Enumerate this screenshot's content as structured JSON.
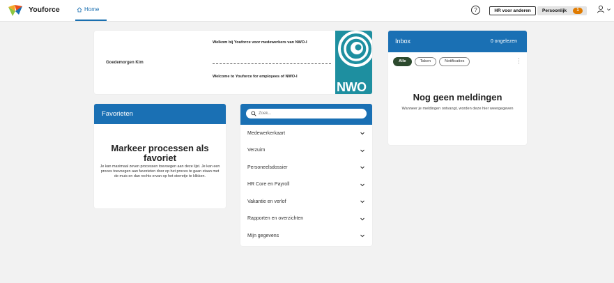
{
  "header": {
    "brand": "Youforce",
    "nav_home": "Home",
    "help_glyph": "?",
    "hr_button": "HR voor anderen",
    "personal_button": "Persoonlijk",
    "personal_badge": "1"
  },
  "welcome": {
    "greeting": "Goedemorgen Kim",
    "text_nl": "Welkom bij Youforce voor medewerkers van NWO-I",
    "text_en": "Welcome to Youforce for employees of NWO-I",
    "logo_text": "NWO"
  },
  "favorites": {
    "header": "Favorieten",
    "title": "Markeer processen als favoriet",
    "description": "Je kan maximaal zeven processen toevoegen aan deze lijst. Je kan een proces toevoegen aan favorieten door op het proces te gaan staan met de muis en dan rechts ervan op het sterretje te klikken."
  },
  "processes": {
    "search_placeholder": "Zoek...",
    "items": [
      "Medewerkerkaart",
      "Verzuim",
      "Personeelsdossier",
      "HR Core en Payroll",
      "Vakantie en verlof",
      "Rapporten en overzichten",
      "Mijn gegevens"
    ]
  },
  "inbox": {
    "header": "Inbox",
    "count": "0 ongelezen",
    "filters": [
      "Alle",
      "Taken",
      "Notificaties"
    ],
    "empty_title": "Nog geen meldingen",
    "empty_description": "Wanneer je meldingen ontvangt, worden deze hier weergegeven"
  },
  "colors": {
    "primary": "#1a70b4",
    "badge": "#e07b00",
    "active_filter": "#2c4a2e",
    "nwo_logo": "#1e8fa0"
  }
}
